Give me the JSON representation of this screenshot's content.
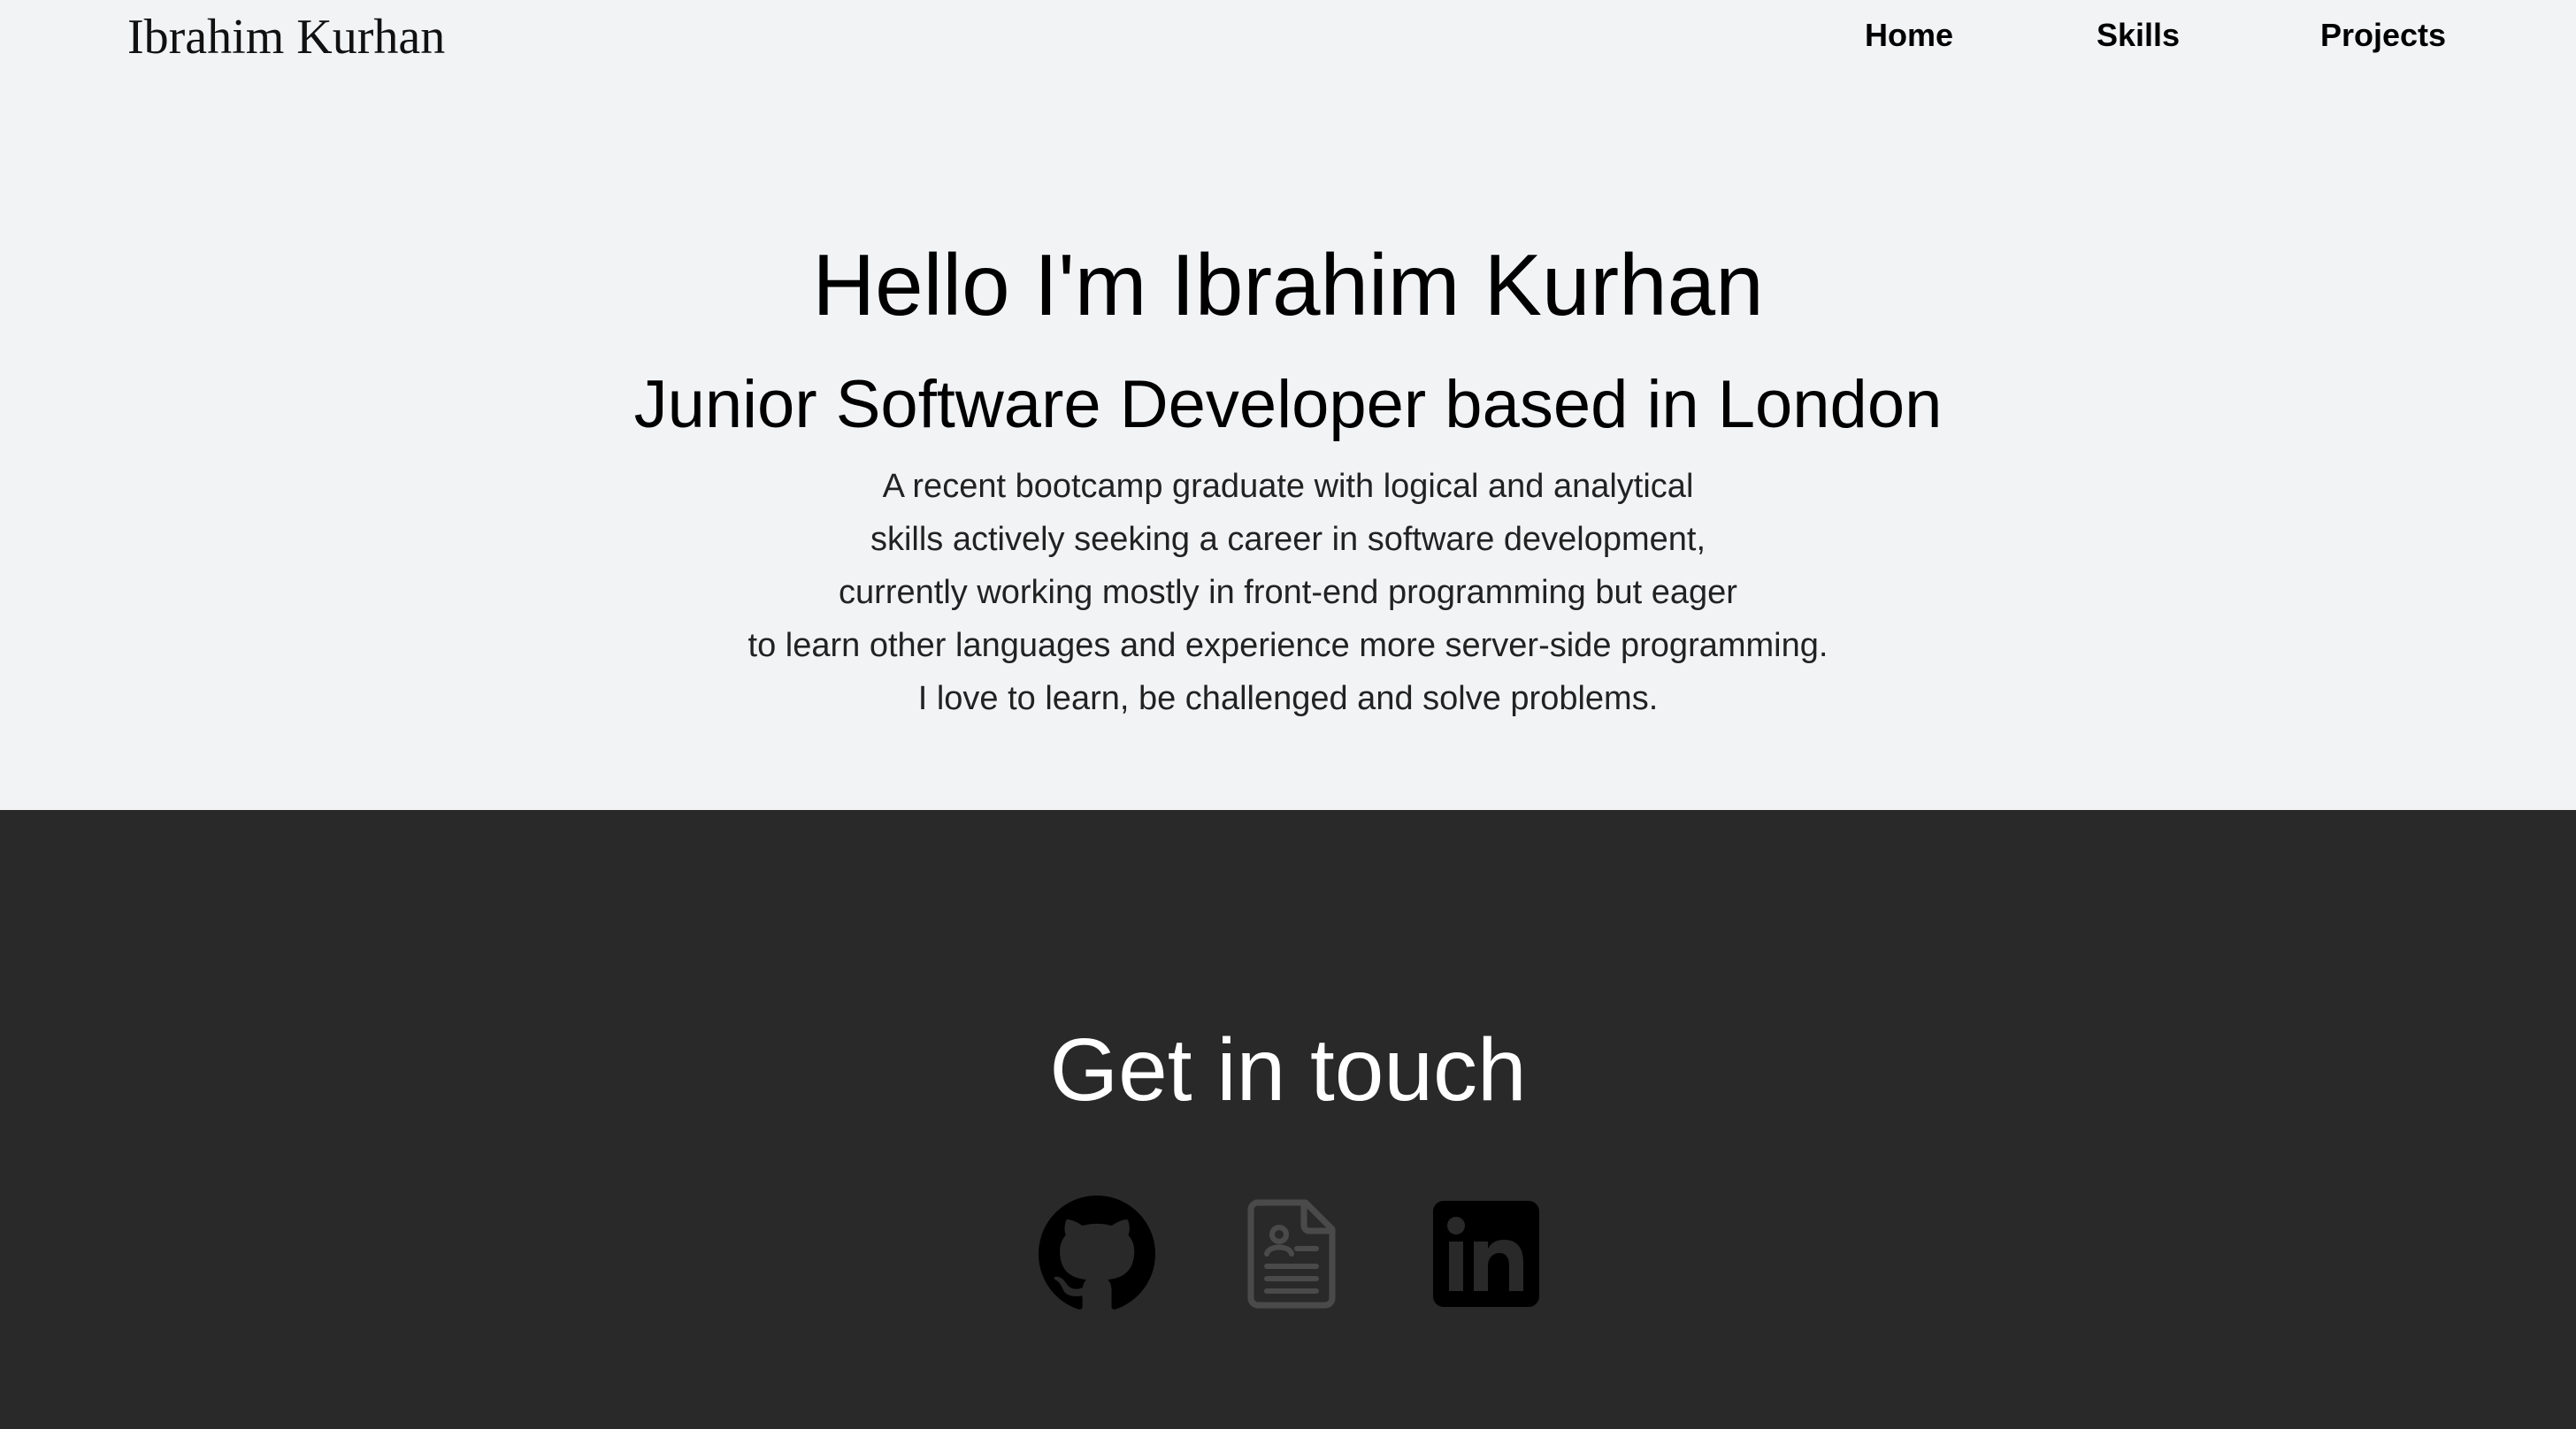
{
  "nav": {
    "brand": "Ibrahim Kurhan",
    "links": [
      {
        "label": "Home"
      },
      {
        "label": "Skills"
      },
      {
        "label": "Projects"
      }
    ]
  },
  "hero": {
    "title": "Hello I'm Ibrahim Kurhan",
    "subtitle": "Junior Software Developer based in London",
    "bio_lines": [
      "A recent bootcamp graduate with logical and analytical",
      "skills actively seeking a career in software development,",
      "currently working mostly in front-end programming but eager",
      "to learn other languages and experience more server-side programming.",
      "I love to learn, be challenged and solve problems."
    ]
  },
  "contact": {
    "title": "Get in touch",
    "icons": [
      {
        "name": "github-icon",
        "color": "#000000"
      },
      {
        "name": "resume-icon",
        "color": "#4a4a4a"
      },
      {
        "name": "linkedin-icon",
        "color": "#000000"
      }
    ]
  },
  "colors": {
    "page_background": "#f2f3f5",
    "contact_background": "#292929",
    "contact_title": "#ffffff"
  }
}
